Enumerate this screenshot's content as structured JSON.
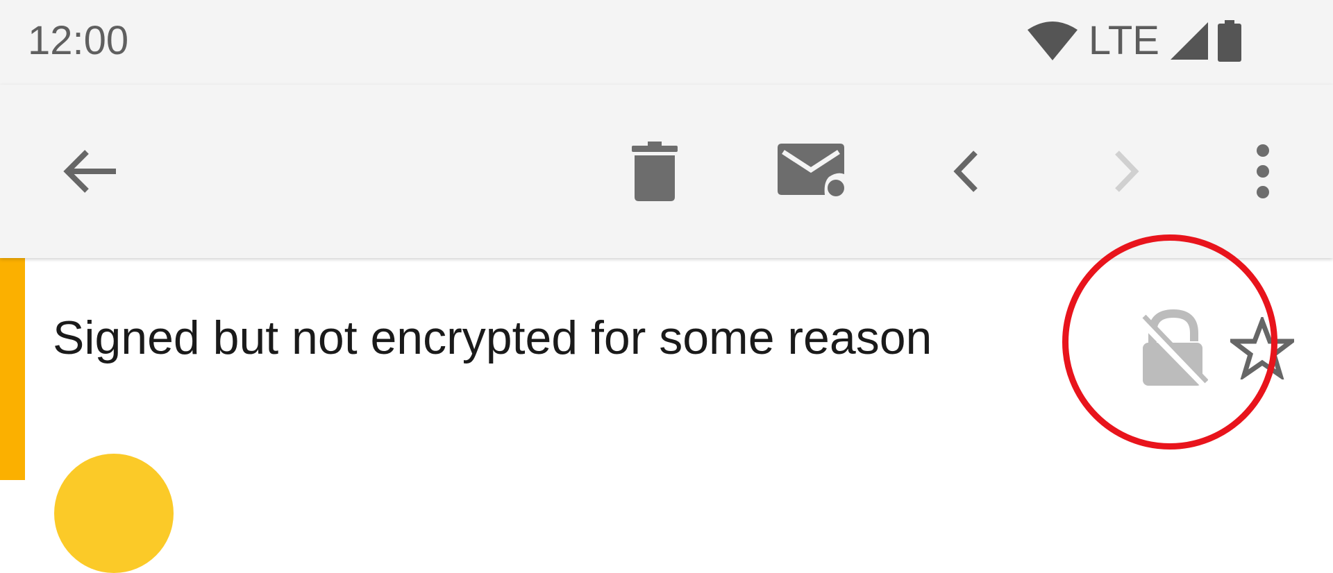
{
  "status_bar": {
    "time": "12:00",
    "network": "LTE",
    "icons": [
      "wifi-icon",
      "signal-icon",
      "battery-icon"
    ]
  },
  "toolbar": {
    "icons": [
      "back-arrow-icon",
      "trash-icon",
      "mark-unread-icon",
      "chevron-left-icon",
      "chevron-right-icon",
      "more-vert-icon"
    ]
  },
  "message": {
    "subject": "Signed but not encrypted for some reason",
    "icons": [
      "lock-off-icon",
      "star-outline-icon"
    ],
    "accent_color": "#fbb000",
    "avatar_color": "#fbca28"
  },
  "annotation": {
    "highlight_color": "#e8141c"
  }
}
